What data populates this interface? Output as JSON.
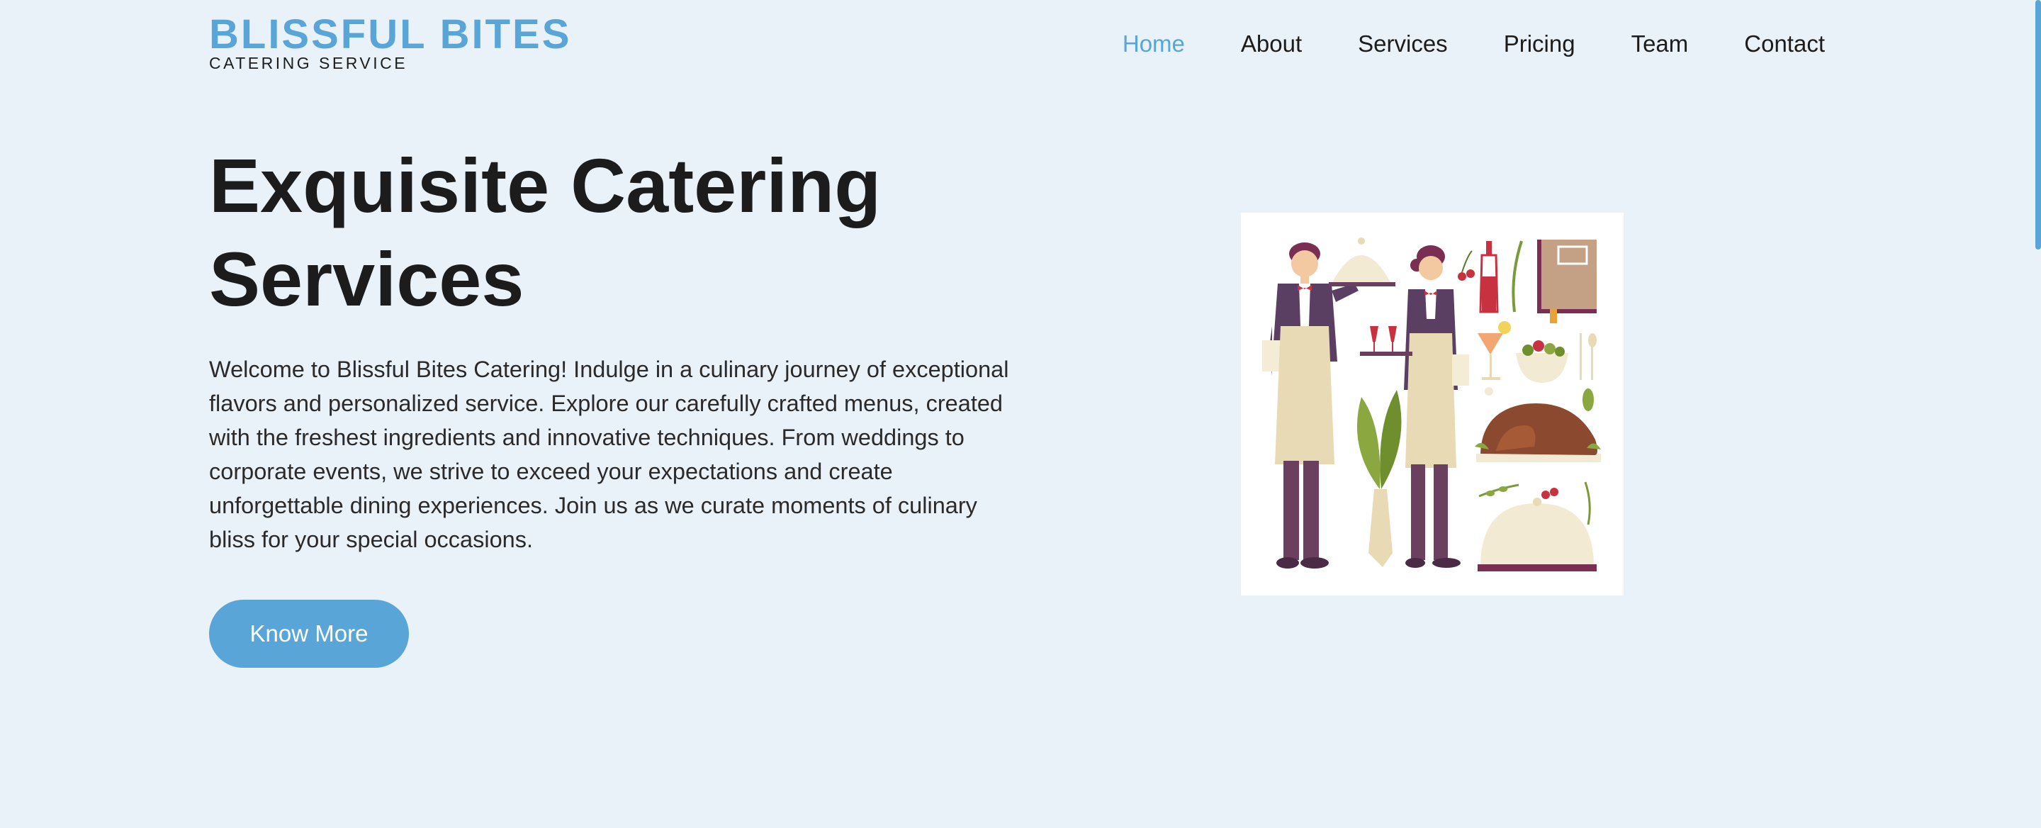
{
  "brand": {
    "title": "BLISSFUL BITES",
    "subtitle": "CATERING SERVICE",
    "accent_color": "#5aa5d8"
  },
  "nav": {
    "items": [
      {
        "label": "Home",
        "active": true
      },
      {
        "label": "About",
        "active": false
      },
      {
        "label": "Services",
        "active": false
      },
      {
        "label": "Pricing",
        "active": false
      },
      {
        "label": "Team",
        "active": false
      },
      {
        "label": "Contact",
        "active": false
      }
    ]
  },
  "hero": {
    "title_line1": "Exquisite Catering",
    "title_line2": "Services",
    "description": "Welcome to Blissful Bites Catering! Indulge in a culinary journey of exceptional flavors and personalized service. Explore our carefully crafted menus, created with the freshest ingredients and innovative techniques. From weddings to corporate events, we strive to exceed your expectations and create unforgettable dining experiences. Join us as we curate moments of culinary bliss for your special occasions.",
    "cta_label": "Know More"
  },
  "illustration": {
    "icon": "catering-waiters-illustration"
  },
  "colors": {
    "background": "#eaf2f9",
    "text": "#1c1c1c",
    "button": "#5aa5d8"
  }
}
